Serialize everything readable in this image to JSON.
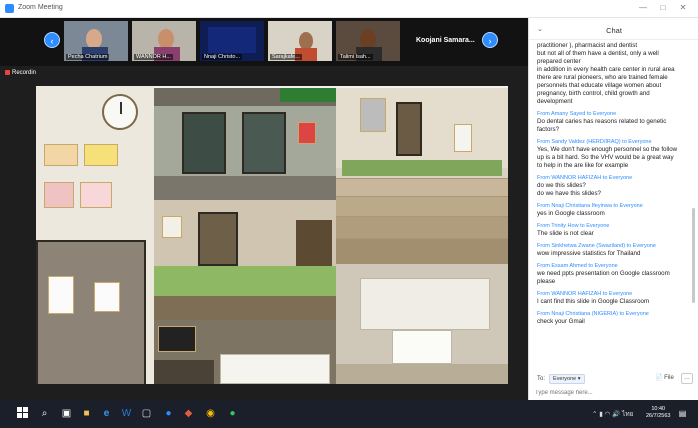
{
  "window": {
    "title": "Zoom Meeting",
    "min": "—",
    "max": "□",
    "close": "✕"
  },
  "gallery": {
    "prev": "‹",
    "next": "›",
    "participants": [
      {
        "name": "Pecha Chatrium"
      },
      {
        "name": "WANNOR H..."
      },
      {
        "name": "Nnaji Christo..."
      },
      {
        "name": "Sarajkafe..."
      },
      {
        "name": "Talimi Isah..."
      }
    ],
    "speaker": "Koojani Samara..."
  },
  "recording": {
    "label": "Recording"
  },
  "chat": {
    "title": "Chat",
    "collapse": "⌄",
    "messages": [
      {
        "from": "",
        "lines": [
          "practitioner ), pharmacist and dentist",
          "but not all of them have a dentist, only a well",
          "prepared center",
          "in addition in every health care center in rural area",
          "there are rural pioneers, who are trained female",
          "personnels that educate village women about",
          "pregnancy, birth control, child growth and",
          "development"
        ]
      },
      {
        "from": "From Amany Sayed to Everyone",
        "lines": [
          "Do dental caries has reasons related to genetic",
          "factors?"
        ]
      },
      {
        "from": "From Sandy Valdez (HERD/IRAQ) to Everyone",
        "lines": [
          "Yes, We don't have enough personnel so the follow",
          "up is a bit hard. So the VHV would be a great way",
          "to help in the are like for example"
        ]
      },
      {
        "from": "From WANNOR HAFIZAH to Everyone",
        "lines": [
          "do we this slides?",
          "do we have this slides?"
        ]
      },
      {
        "from": "From Nnaji Christiana Ifeyinwa to Everyone",
        "lines": [
          "yes in Google classroom"
        ]
      },
      {
        "from": "From Trinity How to Everyone",
        "lines": [
          "The slide is not clear"
        ]
      },
      {
        "from": "From Sinkhetwa Zwane (Swaziland) to Everyone",
        "lines": [
          "wow impressive statistics for Thailand"
        ]
      },
      {
        "from": "From Essam Ahmed to Everyone",
        "lines": [
          "we need ppts presentation on Google classroom",
          "please"
        ]
      },
      {
        "from": "From WANNOR HAFIZAH to Everyone",
        "lines": [
          "I cant find this slide in Google Classroom"
        ]
      },
      {
        "from": "From Nnaji Christiana (NIGERIA) to Everyone",
        "lines": [
          "check your Gmail"
        ]
      }
    ],
    "to_label": "To:",
    "to_value": "Everyone ▾",
    "file_label": "File",
    "more": "…",
    "placeholder": "Type message here..."
  },
  "taskbar": {
    "time": "10:40",
    "date": "26/7/2563",
    "lang": "ไทย"
  },
  "colors": {
    "accent": "#2d8cff",
    "taskbar": "#1b1f2a",
    "recording": "#e8453c"
  }
}
